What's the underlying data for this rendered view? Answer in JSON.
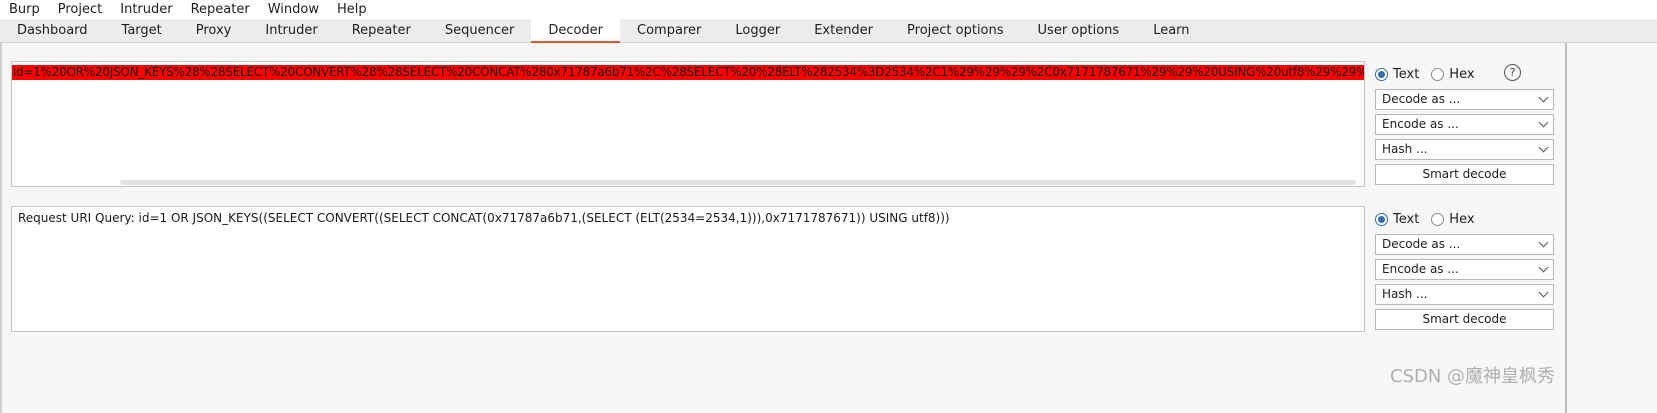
{
  "menu": [
    "Burp",
    "Project",
    "Intruder",
    "Repeater",
    "Window",
    "Help"
  ],
  "tabs": [
    {
      "label": "Dashboard"
    },
    {
      "label": "Target"
    },
    {
      "label": "Proxy"
    },
    {
      "label": "Intruder"
    },
    {
      "label": "Repeater"
    },
    {
      "label": "Sequencer"
    },
    {
      "label": "Decoder",
      "active": true
    },
    {
      "label": "Comparer"
    },
    {
      "label": "Logger"
    },
    {
      "label": "Extender"
    },
    {
      "label": "Project options"
    },
    {
      "label": "User options"
    },
    {
      "label": "Learn"
    }
  ],
  "decoder": {
    "input_text": "id=1%20OR%20JSON_KEYS%28%28SELECT%20CONVERT%28%28SELECT%20CONCAT%280x71787a6b71%2C%28SELECT%20%28ELT%282534%3D2534%2C1%29%29%29%2C0x7171787671%29%29%20USING%20utf8%29%29%29",
    "output_text": "Request URI Query: id=1 OR JSON_KEYS((SELECT CONVERT((SELECT CONCAT(0x71787a6b71,(SELECT (ELT(2534=2534,1))),0x7171787671)) USING utf8)))",
    "highlight_color": "#ff0000",
    "panels": [
      {
        "radio_text": "Text",
        "radio_hex": "Hex",
        "selected": "Text",
        "decode_label": "Decode as ...",
        "encode_label": "Encode as ...",
        "hash_label": "Hash ...",
        "smart_label": "Smart decode",
        "help_glyph": "?"
      },
      {
        "radio_text": "Text",
        "radio_hex": "Hex",
        "selected": "Text",
        "decode_label": "Decode as ...",
        "encode_label": "Encode as ...",
        "hash_label": "Hash ...",
        "smart_label": "Smart decode"
      }
    ]
  },
  "watermark": "CSDN @魔神皇枫秀",
  "colors": {
    "accent": "#e8552c",
    "radio": "#2f6fad"
  }
}
